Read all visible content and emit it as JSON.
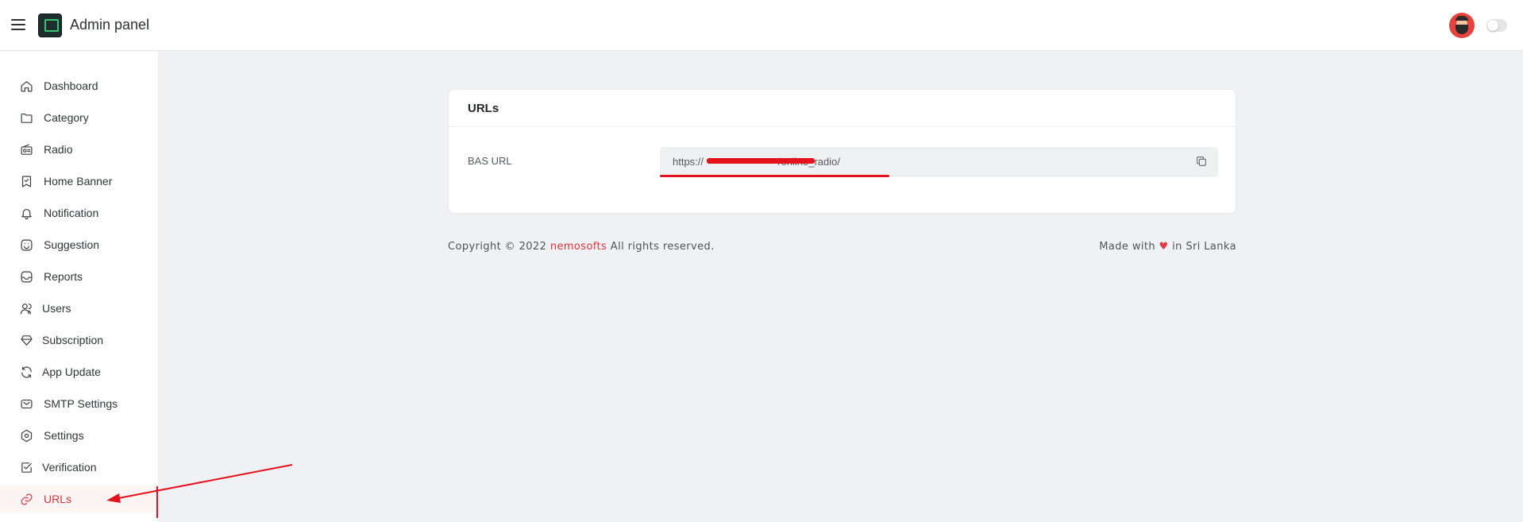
{
  "header": {
    "menu_icon": "hamburger-icon",
    "logo_icon": "radio-logo-icon",
    "title": "Admin panel",
    "avatar_icon": "user-avatar",
    "theme_toggle": "off"
  },
  "sidebar": {
    "items": [
      {
        "label": "Dashboard",
        "icon": "home-icon"
      },
      {
        "label": "Category",
        "icon": "folder-icon"
      },
      {
        "label": "Radio",
        "icon": "radio-icon"
      },
      {
        "label": "Home Banner",
        "icon": "banner-icon"
      },
      {
        "label": "Notification",
        "icon": "bell-icon"
      },
      {
        "label": "Suggestion",
        "icon": "suggestion-icon"
      },
      {
        "label": "Reports",
        "icon": "reports-icon"
      },
      {
        "label": "Users",
        "icon": "users-icon"
      },
      {
        "label": "Subscription",
        "icon": "diamond-icon"
      },
      {
        "label": "App Update",
        "icon": "refresh-icon"
      },
      {
        "label": "SMTP Settings",
        "icon": "mail-icon"
      },
      {
        "label": "Settings",
        "icon": "gear-icon"
      },
      {
        "label": "Verification",
        "icon": "checkbox-icon"
      },
      {
        "label": "URLs",
        "icon": "link-icon",
        "active": true
      }
    ]
  },
  "card": {
    "title": "URLs",
    "field_label": "BAS URL",
    "url_value": "https://                          /online_radio/",
    "copy_icon": "copy-icon"
  },
  "footer": {
    "copyright_prefix": "Copyright © 2022",
    "brand": "nemosofts",
    "copyright_suffix": "All rights reserved.",
    "made_prefix": "Made with",
    "heart": "♥",
    "made_suffix": "in Sri Lanka"
  },
  "colors": {
    "accent": "#d8343a",
    "background": "#f0f1f4",
    "annotation_red": "#e4121a"
  }
}
